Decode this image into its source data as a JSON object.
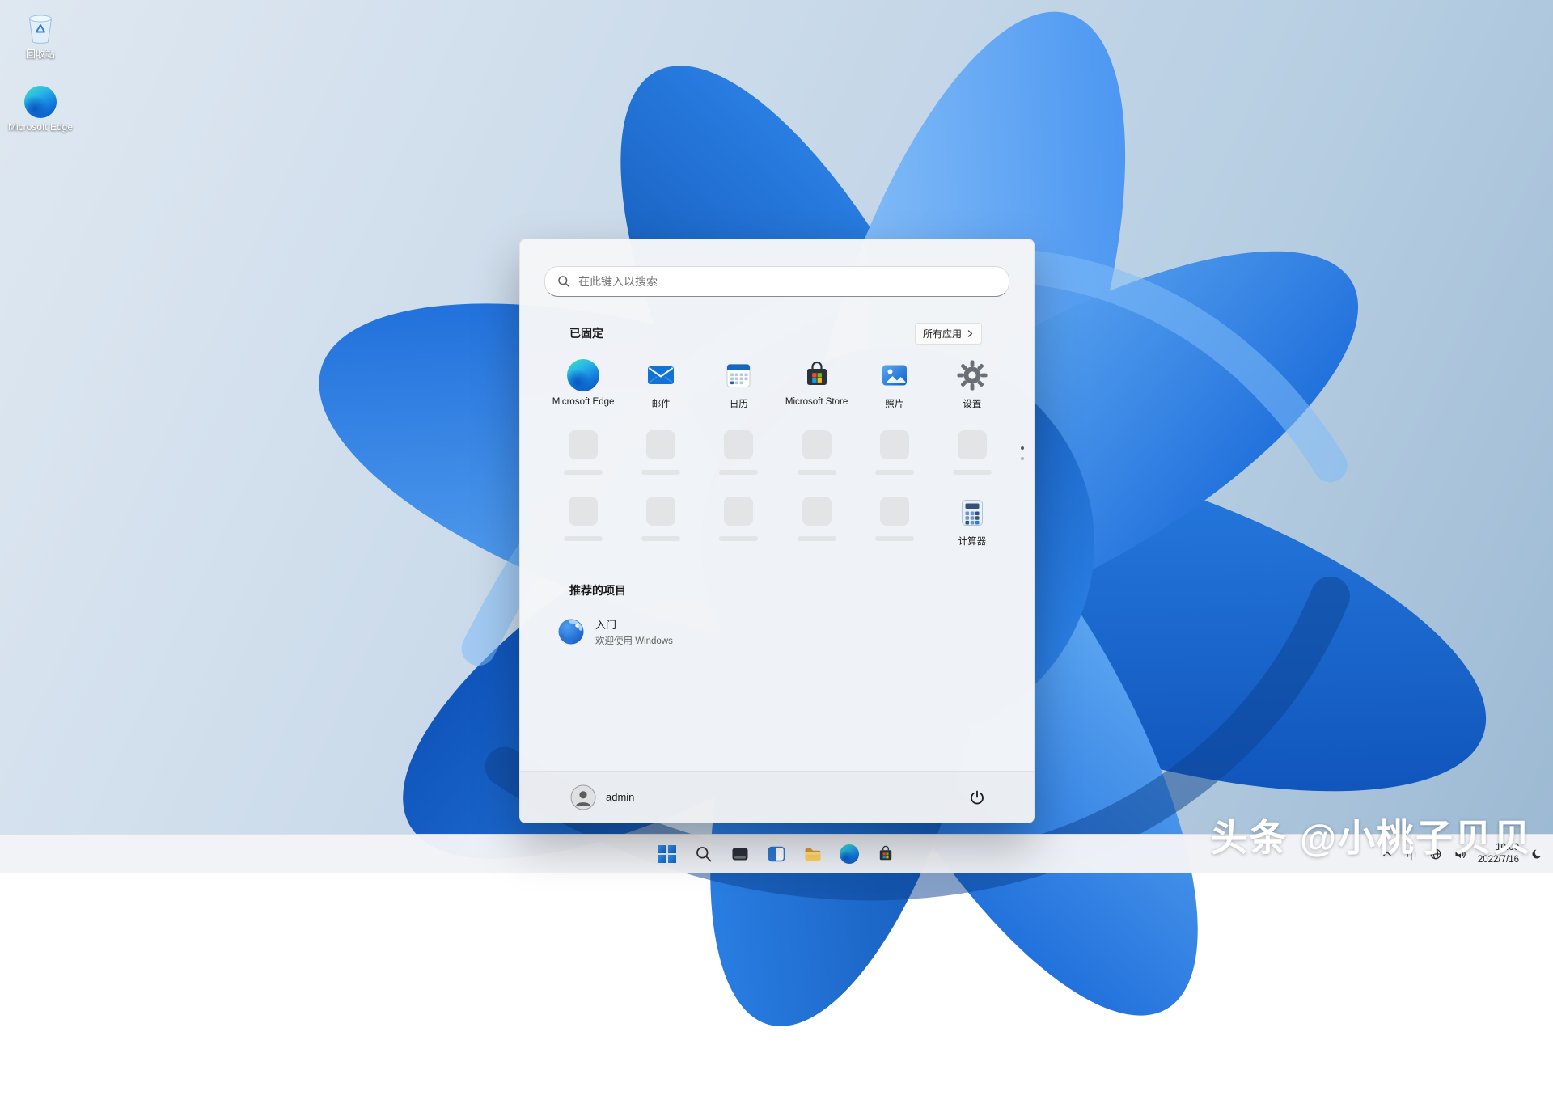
{
  "desktop": {
    "icons": [
      {
        "name": "recycle-bin",
        "label": "回收站"
      },
      {
        "name": "microsoft-edge",
        "label": "Microsoft Edge"
      }
    ]
  },
  "start_menu": {
    "search_placeholder": "在此键入以搜索",
    "pinned_header": "已固定",
    "all_apps_label": "所有应用",
    "pinned_apps": [
      {
        "label": "Microsoft Edge",
        "icon": "edge-icon"
      },
      {
        "label": "邮件",
        "icon": "mail-icon"
      },
      {
        "label": "日历",
        "icon": "calendar-icon"
      },
      {
        "label": "Microsoft Store",
        "icon": "store-icon"
      },
      {
        "label": "照片",
        "icon": "photos-icon"
      },
      {
        "label": "设置",
        "icon": "settings-gear-icon"
      }
    ],
    "placeholder_tile_count": 11,
    "more_pinned": [
      {
        "label": "计算器",
        "icon": "calculator-icon"
      }
    ],
    "page_dots": {
      "count": 2,
      "active_index": 0
    },
    "recommended_header": "推荐的项目",
    "recommended_items": [
      {
        "title": "入门",
        "subtitle": "欢迎使用 Windows",
        "icon": "get-started-icon"
      }
    ],
    "user": {
      "name": "admin",
      "icon": "avatar-icon"
    },
    "power_icon": "power-icon"
  },
  "taskbar": {
    "icons": [
      {
        "name": "start-button",
        "icon": "windows-logo-icon"
      },
      {
        "name": "search-button",
        "icon": "search-icon"
      },
      {
        "name": "task-view-button",
        "icon": "task-view-icon"
      },
      {
        "name": "widgets-button",
        "icon": "widgets-icon"
      },
      {
        "name": "file-explorer-button",
        "icon": "folder-icon"
      },
      {
        "name": "edge-button",
        "icon": "edge-icon"
      },
      {
        "name": "store-button",
        "icon": "store-icon"
      }
    ]
  },
  "tray": {
    "hidden_icons_chevron": "chevron-up-icon",
    "ime_label": "中",
    "icons": [
      "globe-icon",
      "speaker-icon"
    ],
    "time": "10:00",
    "date": "2022/7/16",
    "moon_icon": "moon-icon"
  },
  "watermark": "头条 @小桃子贝贝",
  "colors": {
    "accent": "#0c75da",
    "menu_bg": "#f4f5f7",
    "taskbar_bg": "#f3f4f7",
    "desktop_top": "#dfe8f1",
    "desktop_bottom": "#9cb9d3"
  }
}
